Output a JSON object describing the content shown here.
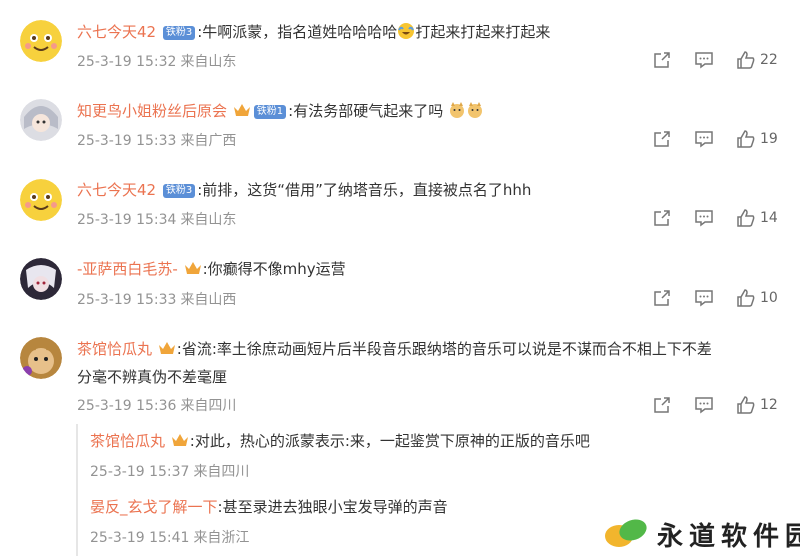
{
  "comments": [
    {
      "username": "六七今天42",
      "badge": "铁粉3",
      "badge_color": "#5b8fd7",
      "text": ":牛啊派蒙，指名道姓哈哈哈哈",
      "text_after_emoji": "打起来打起来打起来",
      "date": "25-3-19 15:32",
      "location": "来自山东",
      "likes": "22"
    },
    {
      "username": "知更鸟小姐粉丝后原会",
      "badge": "铁粉1",
      "badge_color": "#5b8fd7",
      "text": ":有法务部硬气起来了吗",
      "date": "25-3-19 15:33",
      "location": "来自广西",
      "likes": "19"
    },
    {
      "username": "六七今天42",
      "badge": "铁粉3",
      "badge_color": "#5b8fd7",
      "text": ":前排，这货“借用”了纳塔音乐，直接被点名了hhh",
      "date": "25-3-19 15:34",
      "location": "来自山东",
      "likes": "14"
    },
    {
      "username": "-亚萨西白毛苏-",
      "text": ":你癫得不像mhy运营",
      "date": "25-3-19 15:33",
      "location": "来自山西",
      "likes": "10"
    },
    {
      "username": "茶馆恰瓜丸",
      "text": ":省流:率土徐庶动画短片后半段音乐跟纳塔的音乐可以说是不谋而合不相上下不差",
      "text_line2": "分毫不辨真伪不差毫厘",
      "date": "25-3-19 15:36",
      "location": "来自四川",
      "likes": "12"
    }
  ],
  "replies": [
    {
      "username": "茶馆恰瓜丸",
      "text": ":对此，热心的派蒙表示:来，一起鉴赏下原神的正版的音乐吧",
      "date": "25-3-19 15:37",
      "location": "来自四川"
    },
    {
      "username": "晏反_玄戈了解一下",
      "text": ":甚至录进去独眼小宝发导弹的声音",
      "date": "25-3-19 15:41",
      "location": "来自浙江"
    }
  ],
  "watermark": {
    "text": "永道软件园"
  },
  "icons": {
    "share": "share-icon",
    "comment": "comment-icon",
    "like": "thumbs-up-icon"
  },
  "colors": {
    "username": "#eb7350",
    "meta": "#939393"
  }
}
